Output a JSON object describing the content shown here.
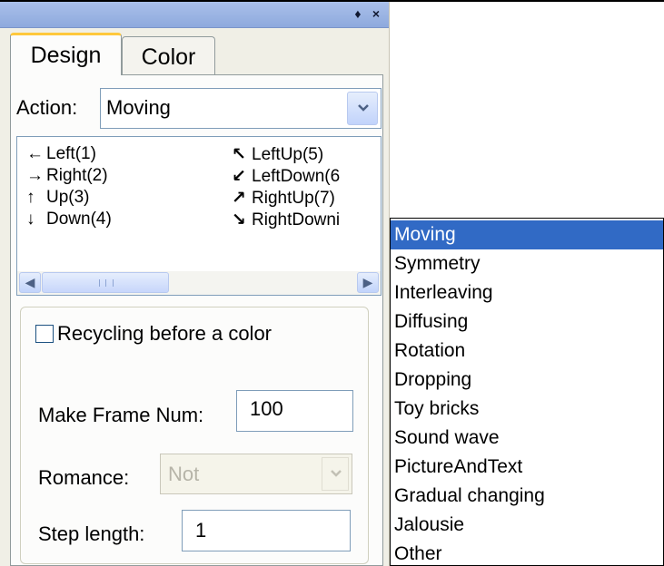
{
  "tabs": {
    "design": "Design",
    "color": "Color"
  },
  "titlebar": {
    "pin_glyph": "♦",
    "close_glyph": "×"
  },
  "action": {
    "label": "Action:",
    "value": "Moving"
  },
  "directions": [
    {
      "glyph": "←",
      "label": "Left(1)"
    },
    {
      "glyph": "→",
      "label": "Right(2)"
    },
    {
      "glyph": "↑",
      "label": "Up(3)"
    },
    {
      "glyph": "↓",
      "label": "Down(4)"
    },
    {
      "glyph": "↖",
      "label": "LeftUp(5)"
    },
    {
      "glyph": "↙",
      "label": "LeftDown(6"
    },
    {
      "glyph": "↗",
      "label": "RightUp(7)"
    },
    {
      "glyph": "↘",
      "label": "RightDowni"
    }
  ],
  "options": {
    "recycling_label": "Recycling before a color",
    "recycling_checked": false,
    "frame_label": "Make Frame Num:",
    "frame_value": "100",
    "romance_label": "Romance:",
    "romance_value": "Not",
    "step_label": "Step length:",
    "step_value": "1"
  },
  "dropdown": {
    "selected_index": 0,
    "items": [
      "Moving",
      "Symmetry",
      "Interleaving",
      "Diffusing",
      "Rotation",
      "Dropping",
      "Toy bricks",
      "Sound wave",
      "PictureAndText",
      "Gradual changing",
      "Jalousie",
      "Other"
    ]
  },
  "colors": {
    "selection": "#316ac5",
    "titlebar": "#9bb4e5",
    "tab_highlight": "#ffc83c"
  }
}
